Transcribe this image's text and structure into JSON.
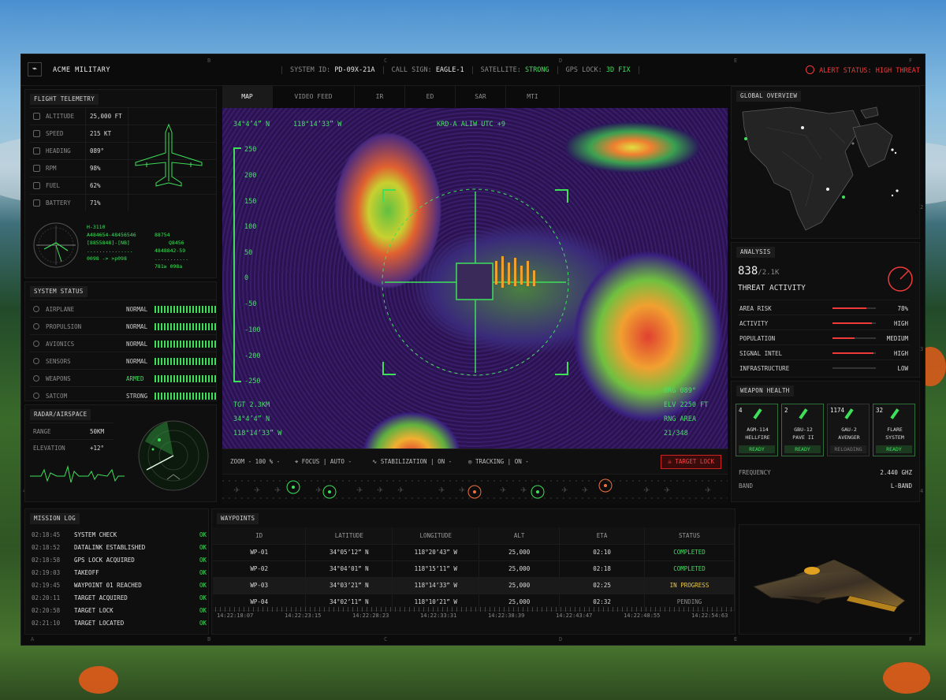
{
  "header": {
    "brand": "ACME MILITARY",
    "system_id_label": "SYSTEM ID:",
    "system_id": "PD-09X-21A",
    "call_sign_label": "CALL SIGN:",
    "call_sign": "EAGLE-1",
    "satellite_label": "SATELLITE:",
    "satellite": "STRONG",
    "gps_label": "GPS LOCK:",
    "gps": "3D FIX",
    "alert": "ALERT STATUS: HIGH THREAT"
  },
  "grid_letters": {
    "a": "A",
    "b": "B",
    "c": "C",
    "d": "D",
    "e": "E",
    "f": "F",
    "n1": "1",
    "n2": "2",
    "n3": "3",
    "n4": "4"
  },
  "telemetry": {
    "title": "FLIGHT TELEMETRY",
    "rows": [
      {
        "label": "ALTITUDE",
        "value": "25,000 FT"
      },
      {
        "label": "SPEED",
        "value": "215 KT"
      },
      {
        "label": "HEADING",
        "value": "089°"
      },
      {
        "label": "RPM",
        "value": "98%"
      },
      {
        "label": "FUEL",
        "value": "62%"
      },
      {
        "label": "BATTERY",
        "value": "71%"
      }
    ],
    "codes_left": [
      "H-3110",
      "A484654-48456546",
      "[8855848]-[NB]",
      "...............",
      "0098 -> >p098"
    ],
    "codes_right": [
      "88754",
      "Q8456",
      "4848842-59",
      "...........",
      "781≥ 098a"
    ]
  },
  "system_status": {
    "title": "SYSTEM STATUS",
    "rows": [
      {
        "label": "AIRPLANE",
        "status": "NORMAL"
      },
      {
        "label": "PROPULSION",
        "status": "NORMAL"
      },
      {
        "label": "AVIONICS",
        "status": "NORMAL"
      },
      {
        "label": "SENSORS",
        "status": "NORMAL"
      },
      {
        "label": "WEAPONS",
        "status": "ARMED"
      },
      {
        "label": "SATCOM",
        "status": "STRONG"
      }
    ]
  },
  "radar": {
    "title": "RADAR/AIRSPACE",
    "range_label": "RANGE",
    "range": "50KM",
    "elevation_label": "ELEVATION",
    "elevation": "+12°"
  },
  "tabs": [
    "MAP",
    "VIDEO FEED",
    "IR",
    "ED",
    "SAR",
    "MTI"
  ],
  "map": {
    "coord_top_lat": "34°4’4” N",
    "coord_top_lon": "118°14’33” W",
    "zone": "KRD-A ALIW UTC +9",
    "scale": [
      "250",
      "200",
      "150",
      "100",
      "50",
      "0",
      "-50",
      "-100",
      "-200",
      "-250"
    ],
    "tgt": "TGT 2.3KM",
    "tgt_lat": "34°4’4” N",
    "tgt_lon": "118°14’33” W",
    "brg": "BRG 089°",
    "elv": "ELV 2250 FT",
    "rng": "RNG AREA",
    "count": "21/348"
  },
  "controls": {
    "zoom_label": "ZOOM",
    "zoom": "100 %",
    "focus_label": "FOCUS",
    "focus": "AUTO",
    "stab_label": "STABILIZATION",
    "stab": "ON",
    "track_label": "TRACKING",
    "track": "ON",
    "target_lock": "TARGET LOCK"
  },
  "global_overview": {
    "title": "GLOBAL OVERVIEW"
  },
  "analysis": {
    "title": "ANALYSIS",
    "count": "838",
    "total": "/2.1K",
    "subtitle": "THREAT ACTIVITY",
    "rows": [
      {
        "label": "AREA RISK",
        "value": "78%",
        "level": 0.78
      },
      {
        "label": "ACTIVITY",
        "value": "HIGH",
        "level": 0.9
      },
      {
        "label": "POPULATION",
        "value": "MEDIUM",
        "level": 0.5
      },
      {
        "label": "SIGNAL INTEL",
        "value": "HIGH",
        "level": 0.95
      },
      {
        "label": "INFRASTRUCTURE",
        "value": "LOW",
        "level": 0.0
      }
    ]
  },
  "weapons": {
    "title": "WEAPON HEALTH",
    "cards": [
      {
        "count": "4",
        "name1": "AGM-114",
        "name2": "HELLFIRE",
        "status": "READY"
      },
      {
        "count": "2",
        "name1": "GBU-12",
        "name2": "PAVE II",
        "status": "READY"
      },
      {
        "count": "1174",
        "name1": "GAU-2",
        "name2": "AVENGER",
        "status": "RELOADING"
      },
      {
        "count": "32",
        "name1": "FLARE",
        "name2": "SYSTEM",
        "status": "READY"
      }
    ],
    "freq_label": "FREQUENCY",
    "freq": "2.440 GHZ",
    "band_label": "BAND",
    "band": "L-BAND"
  },
  "mission_log": {
    "title": "MISSION LOG",
    "entries": [
      {
        "time": "02:18:45",
        "event": "SYSTEM CHECK",
        "status": "OK"
      },
      {
        "time": "02:18:52",
        "event": "DATALINK ESTABLISHED",
        "status": "OK"
      },
      {
        "time": "02:18:58",
        "event": "GPS LOCK ACQUIRED",
        "status": "OK"
      },
      {
        "time": "02:19:03",
        "event": "TAKEOFF",
        "status": "OK"
      },
      {
        "time": "02:19:45",
        "event": "WAYPOINT 01 REACHED",
        "status": "OK"
      },
      {
        "time": "02:20:11",
        "event": "TARGET ACQUIRED",
        "status": "OK"
      },
      {
        "time": "02:20:58",
        "event": "TARGET LOCK",
        "status": "OK"
      },
      {
        "time": "02:21:10",
        "event": "TARGET LOCATED",
        "status": "OK"
      }
    ]
  },
  "waypoints": {
    "title": "WAYPOINTS",
    "columns": [
      "ID",
      "LATITUDE",
      "LONGITUDE",
      "ALT",
      "ETA",
      "STATUS"
    ],
    "rows": [
      {
        "id": "WP-01",
        "lat": "34°05’12” N",
        "lon": "118°20’43” W",
        "alt": "25,000",
        "eta": "02:10",
        "status": "COMPLETED"
      },
      {
        "id": "WP-02",
        "lat": "34°04’01” N",
        "lon": "118°15’11” W",
        "alt": "25,000",
        "eta": "02:18",
        "status": "COMPLETED"
      },
      {
        "id": "WP-03",
        "lat": "34°03’21” N",
        "lon": "118°14’33” W",
        "alt": "25,000",
        "eta": "02:25",
        "status": "IN PROGRESS"
      },
      {
        "id": "WP-04",
        "lat": "34°02’11” N",
        "lon": "118°10’21” W",
        "alt": "25,000",
        "eta": "02:32",
        "status": "PENDING"
      }
    ],
    "timeline": [
      "14:22:18:07",
      "14:22:23:15",
      "14:22:28:23",
      "14:22:33:31",
      "14:22:38:39",
      "14:22:43:47",
      "14:22:48:55",
      "14:22:54:63"
    ]
  },
  "colors": {
    "accent": "#3ee05a",
    "alert": "#f03a3a",
    "warn": "#e8c84a"
  }
}
